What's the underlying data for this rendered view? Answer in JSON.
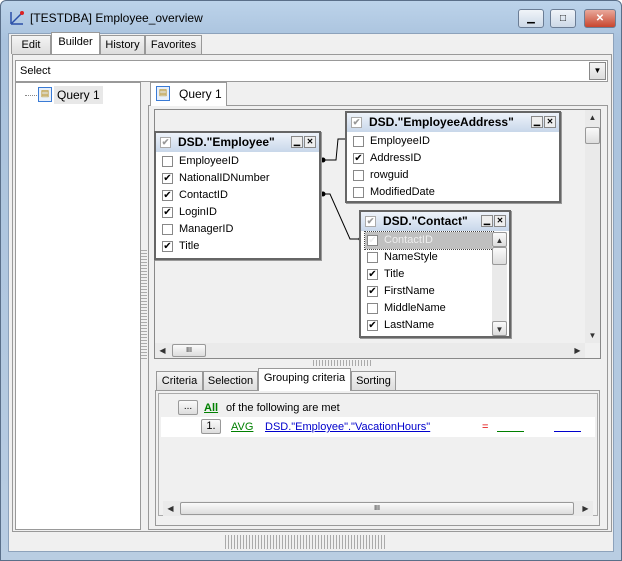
{
  "window": {
    "title": "[TESTDBA] Employee_overview",
    "minimize": "▁",
    "maximize": "□",
    "close": "✕"
  },
  "tabs": [
    "Edit",
    "Builder",
    "History",
    "Favorites"
  ],
  "query_type": {
    "value": "Select"
  },
  "tree": {
    "items": [
      "Query 1"
    ]
  },
  "query_tab": "Query 1",
  "tables": [
    {
      "name": "DSD.\"Employee\"",
      "fields": [
        {
          "label": "EmployeeID",
          "checked": false
        },
        {
          "label": "NationalIDNumber",
          "checked": true
        },
        {
          "label": "ContactID",
          "checked": true
        },
        {
          "label": "LoginID",
          "checked": true
        },
        {
          "label": "ManagerID",
          "checked": false
        },
        {
          "label": "Title",
          "checked": true
        }
      ]
    },
    {
      "name": "DSD.\"EmployeeAddress\"",
      "fields": [
        {
          "label": "EmployeeID",
          "checked": false
        },
        {
          "label": "AddressID",
          "checked": true
        },
        {
          "label": "rowguid",
          "checked": false
        },
        {
          "label": "ModifiedDate",
          "checked": false
        }
      ]
    },
    {
      "name": "DSD.\"Contact\"",
      "fields": [
        {
          "label": "ContactID",
          "checked": true
        },
        {
          "label": "NameStyle",
          "checked": false
        },
        {
          "label": "Title",
          "checked": true
        },
        {
          "label": "FirstName",
          "checked": true
        },
        {
          "label": "MiddleName",
          "checked": false
        },
        {
          "label": "LastName",
          "checked": true
        }
      ]
    }
  ],
  "criteria_tabs": [
    "Criteria",
    "Selection",
    "Grouping criteria",
    "Sorting"
  ],
  "grouping": {
    "ellipsis": "...",
    "all": "All",
    "suffix": "of the following are met",
    "row": {
      "num": "1.",
      "func": "AVG",
      "field": "DSD.\"Employee\".\"VacationHours\"",
      "op": "="
    }
  },
  "scroll": {
    "grip": "III"
  },
  "colors": {
    "green": "#008000",
    "blue": "#0000cc",
    "red": "#e00000"
  }
}
